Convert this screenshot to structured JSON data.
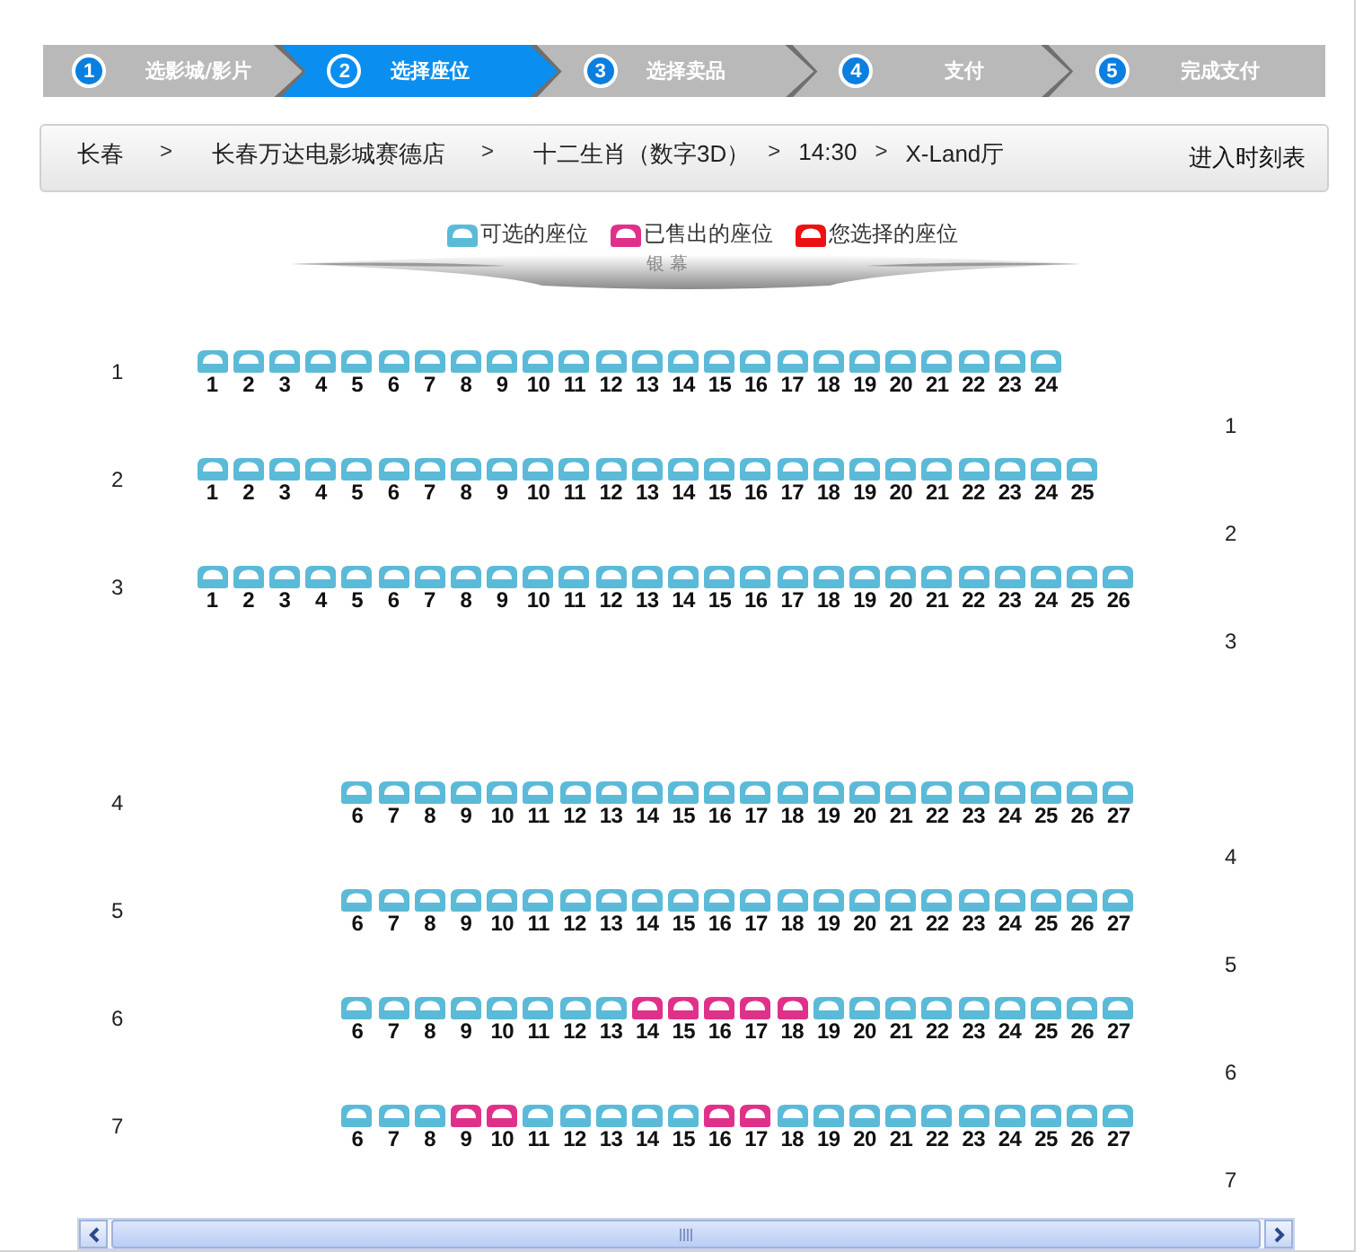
{
  "steps": [
    {
      "number": "1",
      "label": "选影城/影片",
      "selected": false
    },
    {
      "number": "2",
      "label": "选择座位",
      "selected": true
    },
    {
      "number": "3",
      "label": "选择卖品",
      "selected": false
    },
    {
      "number": "4",
      "label": "支付",
      "selected": false
    },
    {
      "number": "5",
      "label": "完成支付",
      "selected": false
    }
  ],
  "breadcrumb": {
    "items": [
      {
        "kind": "crumb",
        "text": "长春"
      },
      {
        "kind": "separator",
        "text": ">"
      },
      {
        "kind": "crumb",
        "text": "长春万达电影城赛德店"
      },
      {
        "kind": "separator",
        "text": ">"
      },
      {
        "kind": "crumb",
        "text": "十二生肖（数字3D）"
      },
      {
        "kind": "separator",
        "text": ">"
      },
      {
        "kind": "crumb",
        "text": "14:30"
      },
      {
        "kind": "separator",
        "text": ">"
      },
      {
        "kind": "crumb",
        "text": "X-Land厅"
      }
    ],
    "link": "进入时刻表"
  },
  "legend": [
    {
      "kind": "available",
      "label": "可选的座位"
    },
    {
      "kind": "sold",
      "label": "已售出的座位"
    },
    {
      "kind": "selected",
      "label": "您选择的座位"
    }
  ],
  "screen": {
    "label": "银 幕"
  },
  "sections": [
    {
      "kind": "front",
      "rows": [
        {
          "label": "1",
          "right_label": "1",
          "seats": [
            {
              "number": "1",
              "kind": "available"
            },
            {
              "number": "2",
              "kind": "available"
            },
            {
              "number": "3",
              "kind": "available"
            },
            {
              "number": "4",
              "kind": "available"
            },
            {
              "number": "5",
              "kind": "available"
            },
            {
              "number": "6",
              "kind": "available"
            },
            {
              "number": "7",
              "kind": "available"
            },
            {
              "number": "8",
              "kind": "available"
            },
            {
              "number": "9",
              "kind": "available"
            },
            {
              "number": "10",
              "kind": "available"
            },
            {
              "number": "11",
              "kind": "available"
            },
            {
              "number": "12",
              "kind": "available"
            },
            {
              "number": "13",
              "kind": "available"
            },
            {
              "number": "14",
              "kind": "available"
            },
            {
              "number": "15",
              "kind": "available"
            },
            {
              "number": "16",
              "kind": "available"
            },
            {
              "number": "17",
              "kind": "available"
            },
            {
              "number": "18",
              "kind": "available"
            },
            {
              "number": "19",
              "kind": "available"
            },
            {
              "number": "20",
              "kind": "available"
            },
            {
              "number": "21",
              "kind": "available"
            },
            {
              "number": "22",
              "kind": "available"
            },
            {
              "number": "23",
              "kind": "available"
            },
            {
              "number": "24",
              "kind": "available"
            }
          ]
        },
        {
          "label": "2",
          "right_label": "2",
          "seats": [
            {
              "number": "1",
              "kind": "available"
            },
            {
              "number": "2",
              "kind": "available"
            },
            {
              "number": "3",
              "kind": "available"
            },
            {
              "number": "4",
              "kind": "available"
            },
            {
              "number": "5",
              "kind": "available"
            },
            {
              "number": "6",
              "kind": "available"
            },
            {
              "number": "7",
              "kind": "available"
            },
            {
              "number": "8",
              "kind": "available"
            },
            {
              "number": "9",
              "kind": "available"
            },
            {
              "number": "10",
              "kind": "available"
            },
            {
              "number": "11",
              "kind": "available"
            },
            {
              "number": "12",
              "kind": "available"
            },
            {
              "number": "13",
              "kind": "available"
            },
            {
              "number": "14",
              "kind": "available"
            },
            {
              "number": "15",
              "kind": "available"
            },
            {
              "number": "16",
              "kind": "available"
            },
            {
              "number": "17",
              "kind": "available"
            },
            {
              "number": "18",
              "kind": "available"
            },
            {
              "number": "19",
              "kind": "available"
            },
            {
              "number": "20",
              "kind": "available"
            },
            {
              "number": "21",
              "kind": "available"
            },
            {
              "number": "22",
              "kind": "available"
            },
            {
              "number": "23",
              "kind": "available"
            },
            {
              "number": "24",
              "kind": "available"
            },
            {
              "number": "25",
              "kind": "available"
            }
          ]
        },
        {
          "label": "3",
          "right_label": "3",
          "seats": [
            {
              "number": "1",
              "kind": "available"
            },
            {
              "number": "2",
              "kind": "available"
            },
            {
              "number": "3",
              "kind": "available"
            },
            {
              "number": "4",
              "kind": "available"
            },
            {
              "number": "5",
              "kind": "available"
            },
            {
              "number": "6",
              "kind": "available"
            },
            {
              "number": "7",
              "kind": "available"
            },
            {
              "number": "8",
              "kind": "available"
            },
            {
              "number": "9",
              "kind": "available"
            },
            {
              "number": "10",
              "kind": "available"
            },
            {
              "number": "11",
              "kind": "available"
            },
            {
              "number": "12",
              "kind": "available"
            },
            {
              "number": "13",
              "kind": "available"
            },
            {
              "number": "14",
              "kind": "available"
            },
            {
              "number": "15",
              "kind": "available"
            },
            {
              "number": "16",
              "kind": "available"
            },
            {
              "number": "17",
              "kind": "available"
            },
            {
              "number": "18",
              "kind": "available"
            },
            {
              "number": "19",
              "kind": "available"
            },
            {
              "number": "20",
              "kind": "available"
            },
            {
              "number": "21",
              "kind": "available"
            },
            {
              "number": "22",
              "kind": "available"
            },
            {
              "number": "23",
              "kind": "available"
            },
            {
              "number": "24",
              "kind": "available"
            },
            {
              "number": "25",
              "kind": "available"
            },
            {
              "number": "26",
              "kind": "available"
            }
          ]
        }
      ]
    },
    {
      "kind": "rear",
      "rows": [
        {
          "label": "4",
          "right_label": "4",
          "seats": [
            {
              "number": "6",
              "kind": "available"
            },
            {
              "number": "7",
              "kind": "available"
            },
            {
              "number": "8",
              "kind": "available"
            },
            {
              "number": "9",
              "kind": "available"
            },
            {
              "number": "10",
              "kind": "available"
            },
            {
              "number": "11",
              "kind": "available"
            },
            {
              "number": "12",
              "kind": "available"
            },
            {
              "number": "13",
              "kind": "available"
            },
            {
              "number": "14",
              "kind": "available"
            },
            {
              "number": "15",
              "kind": "available"
            },
            {
              "number": "16",
              "kind": "available"
            },
            {
              "number": "17",
              "kind": "available"
            },
            {
              "number": "18",
              "kind": "available"
            },
            {
              "number": "19",
              "kind": "available"
            },
            {
              "number": "20",
              "kind": "available"
            },
            {
              "number": "21",
              "kind": "available"
            },
            {
              "number": "22",
              "kind": "available"
            },
            {
              "number": "23",
              "kind": "available"
            },
            {
              "number": "24",
              "kind": "available"
            },
            {
              "number": "25",
              "kind": "available"
            },
            {
              "number": "26",
              "kind": "available"
            },
            {
              "number": "27",
              "kind": "available"
            }
          ]
        },
        {
          "label": "5",
          "right_label": "5",
          "seats": [
            {
              "number": "6",
              "kind": "available"
            },
            {
              "number": "7",
              "kind": "available"
            },
            {
              "number": "8",
              "kind": "available"
            },
            {
              "number": "9",
              "kind": "available"
            },
            {
              "number": "10",
              "kind": "available"
            },
            {
              "number": "11",
              "kind": "available"
            },
            {
              "number": "12",
              "kind": "available"
            },
            {
              "number": "13",
              "kind": "available"
            },
            {
              "number": "14",
              "kind": "available"
            },
            {
              "number": "15",
              "kind": "available"
            },
            {
              "number": "16",
              "kind": "available"
            },
            {
              "number": "17",
              "kind": "available"
            },
            {
              "number": "18",
              "kind": "available"
            },
            {
              "number": "19",
              "kind": "available"
            },
            {
              "number": "20",
              "kind": "available"
            },
            {
              "number": "21",
              "kind": "available"
            },
            {
              "number": "22",
              "kind": "available"
            },
            {
              "number": "23",
              "kind": "available"
            },
            {
              "number": "24",
              "kind": "available"
            },
            {
              "number": "25",
              "kind": "available"
            },
            {
              "number": "26",
              "kind": "available"
            },
            {
              "number": "27",
              "kind": "available"
            }
          ]
        },
        {
          "label": "6",
          "right_label": "6",
          "seats": [
            {
              "number": "6",
              "kind": "available"
            },
            {
              "number": "7",
              "kind": "available"
            },
            {
              "number": "8",
              "kind": "available"
            },
            {
              "number": "9",
              "kind": "available"
            },
            {
              "number": "10",
              "kind": "available"
            },
            {
              "number": "11",
              "kind": "available"
            },
            {
              "number": "12",
              "kind": "available"
            },
            {
              "number": "13",
              "kind": "available"
            },
            {
              "number": "14",
              "kind": "sold"
            },
            {
              "number": "15",
              "kind": "sold"
            },
            {
              "number": "16",
              "kind": "sold"
            },
            {
              "number": "17",
              "kind": "sold"
            },
            {
              "number": "18",
              "kind": "sold"
            },
            {
              "number": "19",
              "kind": "available"
            },
            {
              "number": "20",
              "kind": "available"
            },
            {
              "number": "21",
              "kind": "available"
            },
            {
              "number": "22",
              "kind": "available"
            },
            {
              "number": "23",
              "kind": "available"
            },
            {
              "number": "24",
              "kind": "available"
            },
            {
              "number": "25",
              "kind": "available"
            },
            {
              "number": "26",
              "kind": "available"
            },
            {
              "number": "27",
              "kind": "available"
            }
          ]
        },
        {
          "label": "7",
          "right_label": "7",
          "seats": [
            {
              "number": "6",
              "kind": "available"
            },
            {
              "number": "7",
              "kind": "available"
            },
            {
              "number": "8",
              "kind": "available"
            },
            {
              "number": "9",
              "kind": "sold"
            },
            {
              "number": "10",
              "kind": "sold"
            },
            {
              "number": "11",
              "kind": "available"
            },
            {
              "number": "12",
              "kind": "available"
            },
            {
              "number": "13",
              "kind": "available"
            },
            {
              "number": "14",
              "kind": "available"
            },
            {
              "number": "15",
              "kind": "available"
            },
            {
              "number": "16",
              "kind": "sold"
            },
            {
              "number": "17",
              "kind": "sold"
            },
            {
              "number": "18",
              "kind": "available"
            },
            {
              "number": "19",
              "kind": "available"
            },
            {
              "number": "20",
              "kind": "available"
            },
            {
              "number": "21",
              "kind": "available"
            },
            {
              "number": "22",
              "kind": "available"
            },
            {
              "number": "23",
              "kind": "available"
            },
            {
              "number": "24",
              "kind": "available"
            },
            {
              "number": "25",
              "kind": "available"
            },
            {
              "number": "26",
              "kind": "available"
            },
            {
              "number": "27",
              "kind": "available"
            }
          ]
        }
      ]
    }
  ]
}
